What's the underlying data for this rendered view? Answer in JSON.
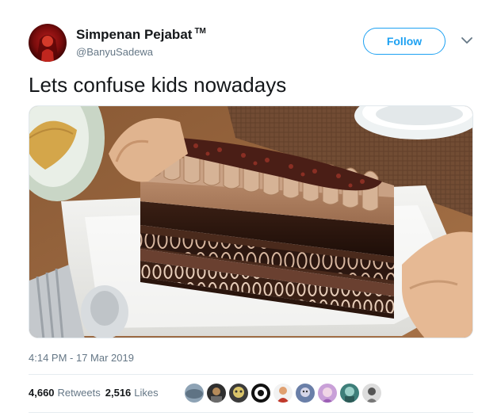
{
  "author": {
    "name": "Simpenan Pejabat",
    "tm": "TM",
    "handle": "@BanyuSadewa"
  },
  "follow_button": "Follow",
  "tweet_text": "Lets confuse kids nowadays",
  "timestamp": "4:14 PM - 17 Mar 2019",
  "stats": {
    "retweets_count": "4,660",
    "retweets_label": "Retweets",
    "likes_count": "2,516",
    "likes_label": "Likes"
  },
  "colors": {
    "accent": "#1da1f2",
    "secondary_text": "#657786",
    "divider": "#e6ecf0"
  },
  "icons": {
    "caret": "chevron-down-icon"
  }
}
